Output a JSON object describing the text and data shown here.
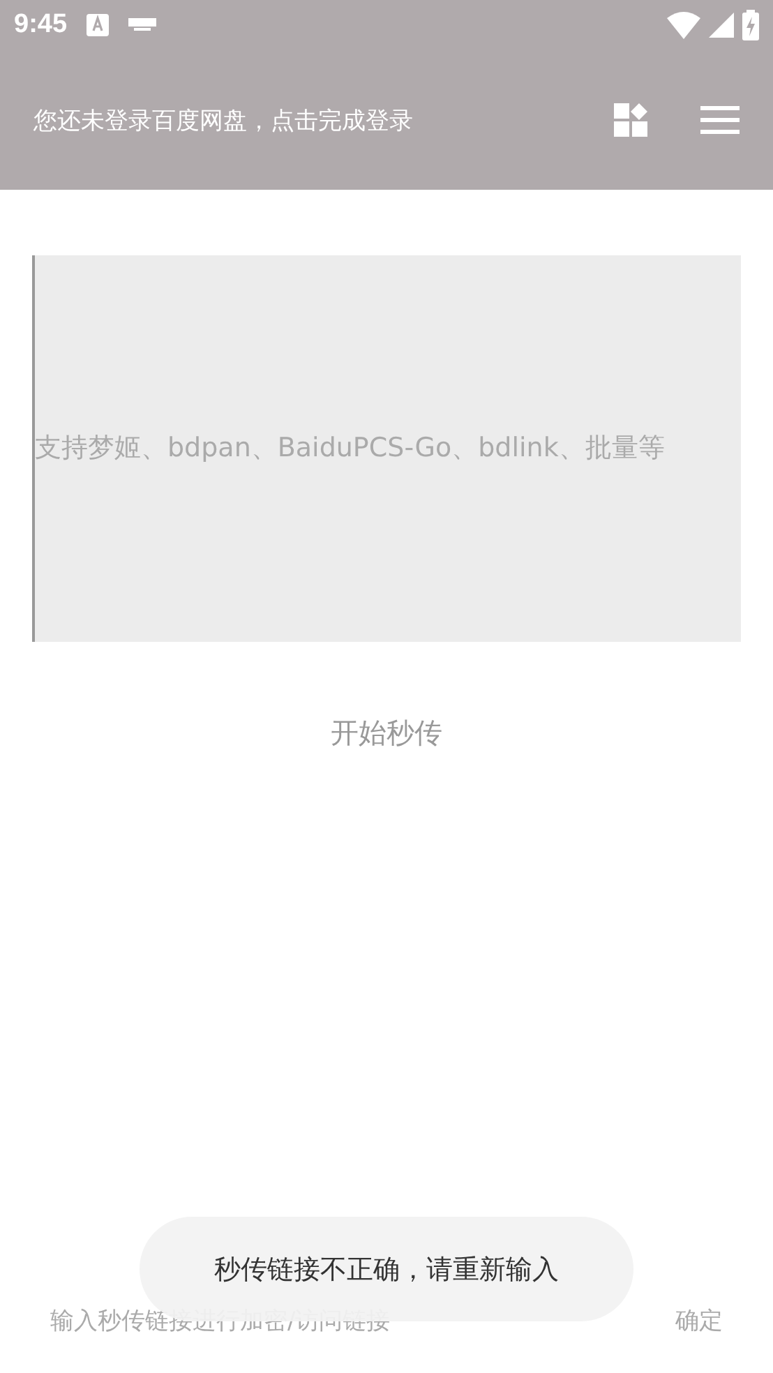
{
  "status_bar": {
    "time": "9:45"
  },
  "app_bar": {
    "title": "您还未登录百度网盘，点击完成登录"
  },
  "link_input": {
    "placeholder": "支持梦姬、bdpan、BaiduPCS-Go、bdlink、批量等"
  },
  "start_button": {
    "label": "开始秒传"
  },
  "encrypt_input": {
    "placeholder": "输入秒传链接进行加密/访问链接"
  },
  "confirm_button": {
    "label": "确定"
  },
  "toast": {
    "message": "秒传链接不正确，请重新输入"
  }
}
